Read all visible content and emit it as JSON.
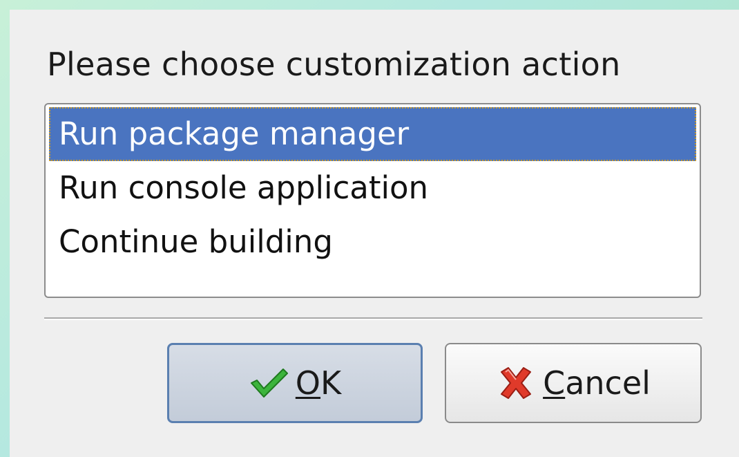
{
  "dialog": {
    "prompt": "Please choose customization action",
    "list": {
      "items": [
        {
          "label": "Run package manager",
          "selected": true
        },
        {
          "label": "Run console application",
          "selected": false
        },
        {
          "label": "Continue building",
          "selected": false
        }
      ]
    },
    "buttons": {
      "ok": {
        "mnemonic": "O",
        "rest": "K",
        "icon": "checkmark-icon"
      },
      "cancel": {
        "mnemonic": "C",
        "rest": "ancel",
        "icon": "red-x-icon"
      }
    }
  },
  "colors": {
    "selection": "#4a74c0",
    "check": "#3cb43c",
    "cancel_x": "#e03a2a"
  }
}
